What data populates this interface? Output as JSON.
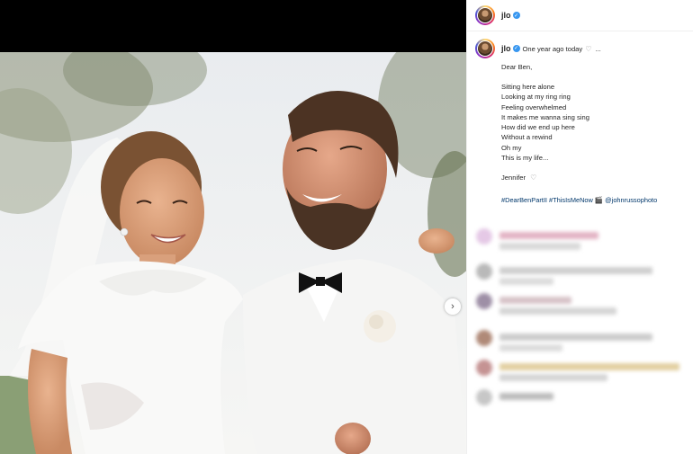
{
  "post": {
    "username": "jlo",
    "verified_icon": "verified-badge-icon",
    "time_ago": "One year ago today",
    "caption_greeting": "Dear Ben,",
    "caption_lines": [
      "Sitting here alone",
      "Looking at my ring ring",
      "Feeling overwhelmed",
      "It makes me wanna sing sing",
      "How did we end up here",
      "Without a rewind",
      "Oh my",
      "This is my life..."
    ],
    "signature": "Jennifer",
    "tags": "#DearBenPartII #ThisIsMeNow 🎬 @johnrussophoto"
  },
  "controls": {
    "next_arrow": "›"
  },
  "colors": {
    "link_blue": "#00376b",
    "verified_blue": "#3897f0"
  }
}
